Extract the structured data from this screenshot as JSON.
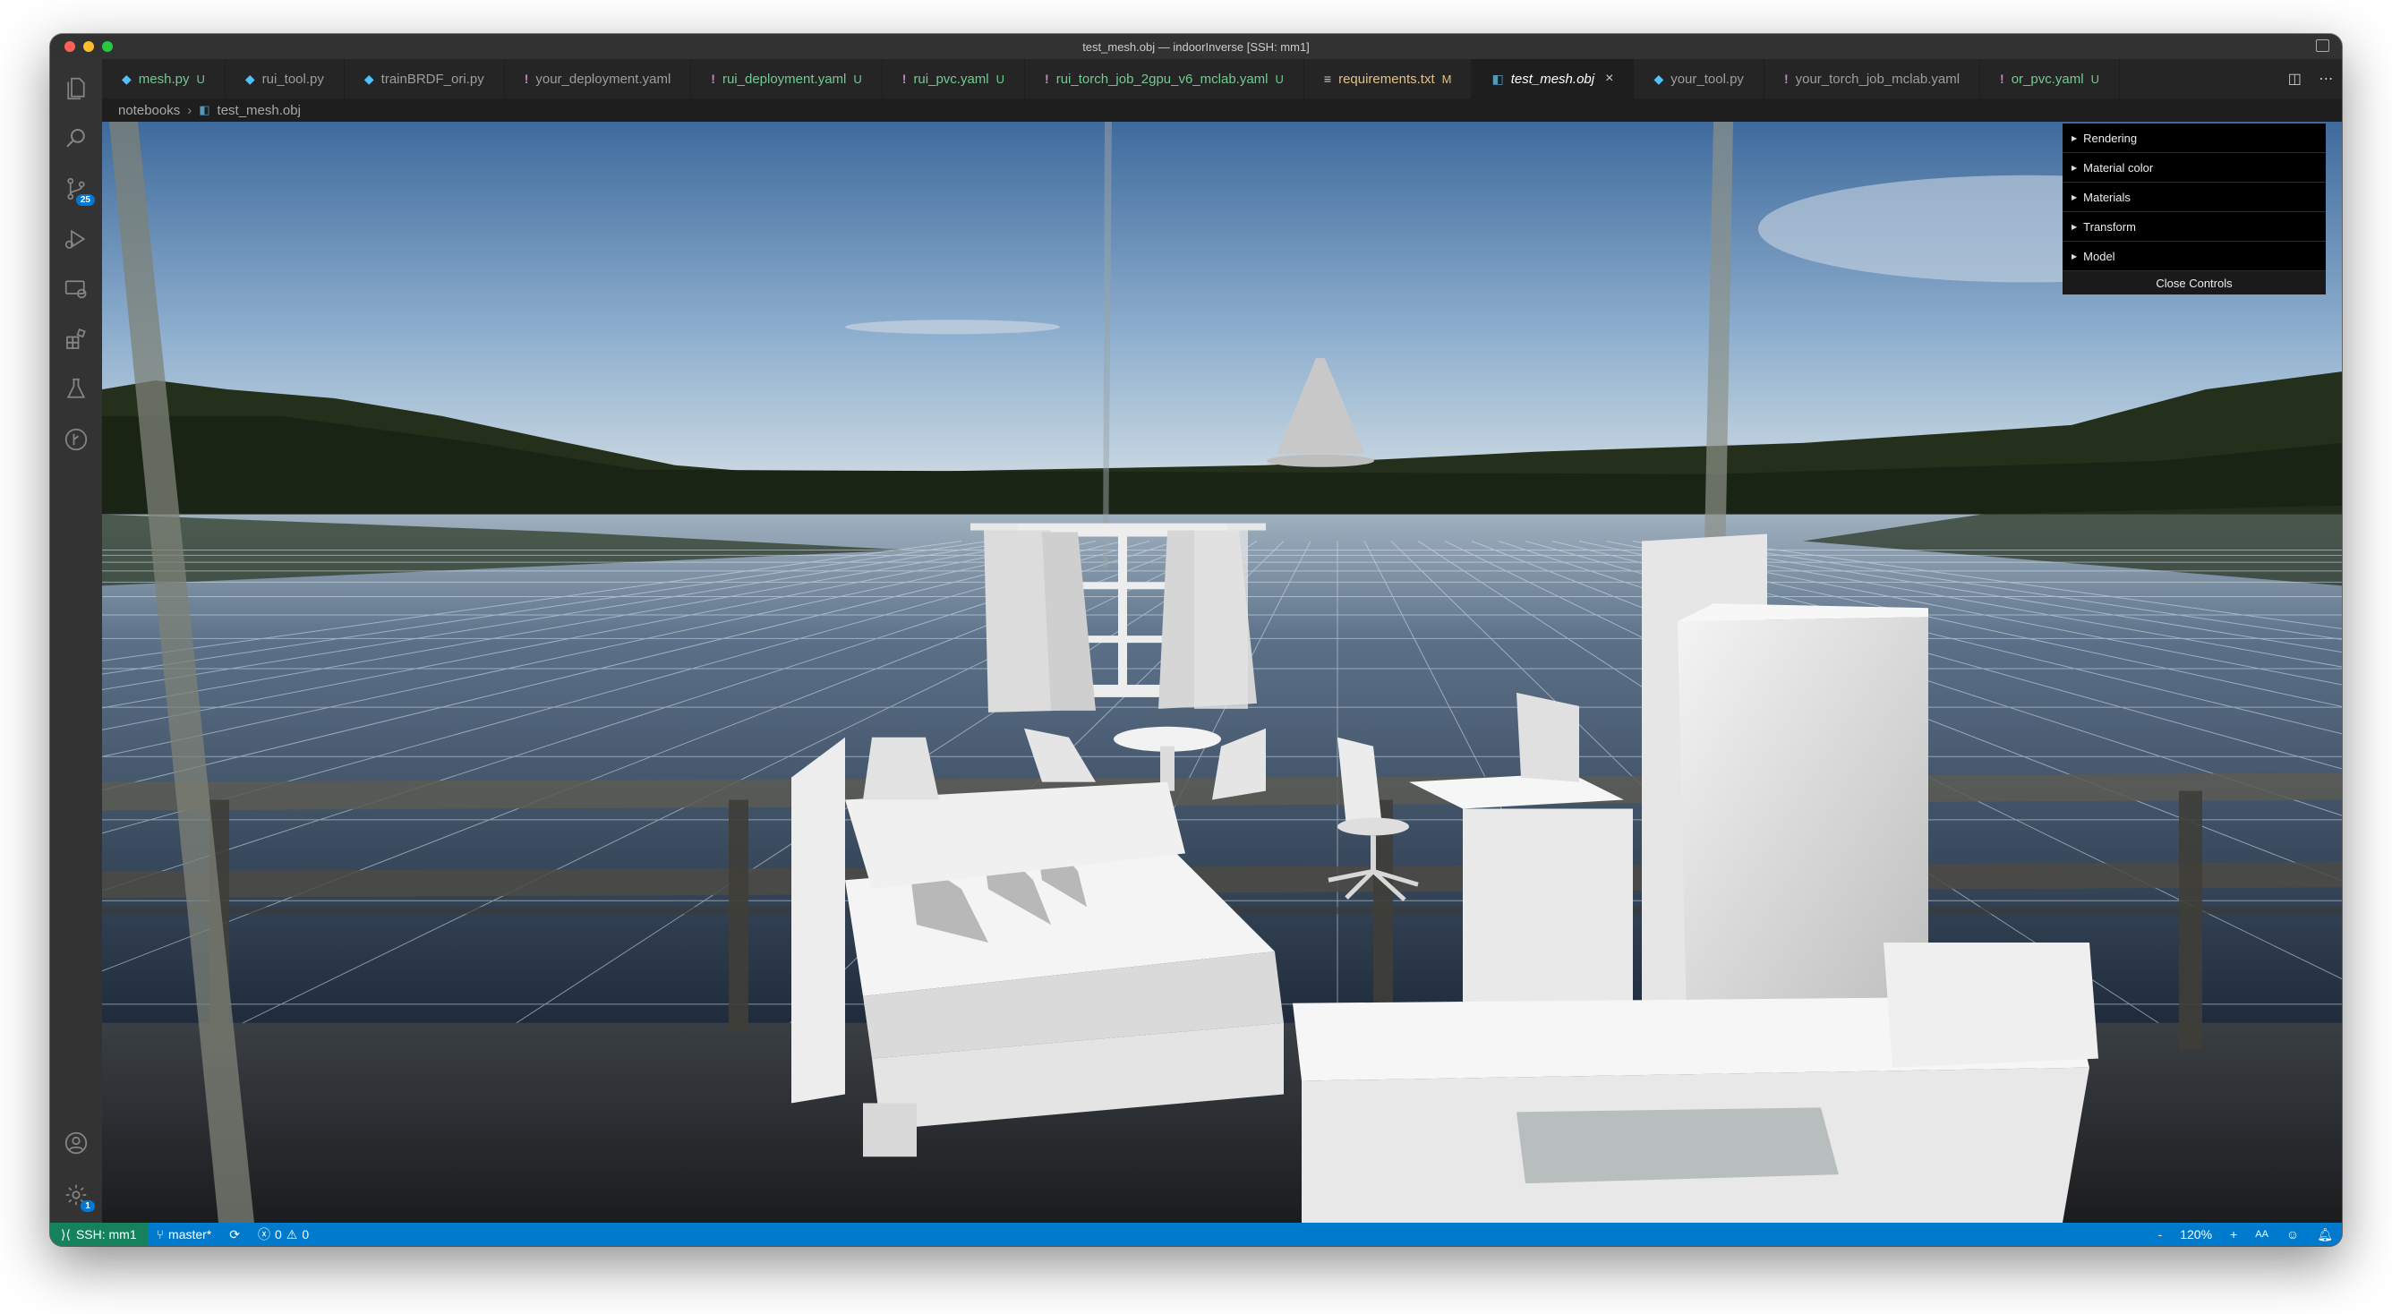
{
  "window": {
    "title": "test_mesh.obj — indoorInverse [SSH: mm1]"
  },
  "activity_bar": {
    "source_control_badge": "25",
    "manage_badge": "1"
  },
  "tabs": [
    {
      "label": "mesh.py",
      "status": "U",
      "icon": "python-file-icon",
      "state": "untracked"
    },
    {
      "label": "rui_tool.py",
      "status": "",
      "icon": "python-file-icon",
      "state": "normal"
    },
    {
      "label": "trainBRDF_ori.py",
      "status": "",
      "icon": "python-file-icon",
      "state": "normal"
    },
    {
      "label": "your_deployment.yaml",
      "status": "",
      "icon": "yaml-file-icon",
      "state": "normal"
    },
    {
      "label": "rui_deployment.yaml",
      "status": "U",
      "icon": "yaml-file-icon",
      "state": "untracked"
    },
    {
      "label": "rui_pvc.yaml",
      "status": "U",
      "icon": "yaml-file-icon",
      "state": "untracked"
    },
    {
      "label": "rui_torch_job_2gpu_v6_mclab.yaml",
      "status": "U",
      "icon": "yaml-file-icon",
      "state": "untracked"
    },
    {
      "label": "requirements.txt",
      "status": "M",
      "icon": "text-file-icon",
      "state": "modified"
    },
    {
      "label": "test_mesh.obj",
      "status": "",
      "icon": "obj-file-icon",
      "state": "active"
    },
    {
      "label": "your_tool.py",
      "status": "",
      "icon": "python-file-icon",
      "state": "normal"
    },
    {
      "label": "your_torch_job_mclab.yaml",
      "status": "",
      "icon": "yaml-file-icon",
      "state": "normal"
    },
    {
      "label": "or_pvc.yaml",
      "status": "U",
      "icon": "yaml-file-icon",
      "state": "untracked"
    }
  ],
  "breadcrumb": {
    "folder": "notebooks",
    "file": "test_mesh.obj"
  },
  "controls_panel": {
    "folders": [
      "Rendering",
      "Material color",
      "Materials",
      "Transform",
      "Model"
    ],
    "close_label": "Close Controls"
  },
  "status_bar": {
    "remote": "SSH: mm1",
    "branch": "master*",
    "errors": "0",
    "warnings": "0",
    "zoom_minus": "-",
    "zoom": "120%",
    "zoom_plus": "+",
    "font_size": "AA"
  },
  "colors": {
    "status_bar": "#007acc",
    "remote_indicator": "#16825d",
    "untracked": "#73c991",
    "modified": "#e2c08d",
    "sky_top": "#3f6a9c",
    "lake": "#2b3f58"
  }
}
